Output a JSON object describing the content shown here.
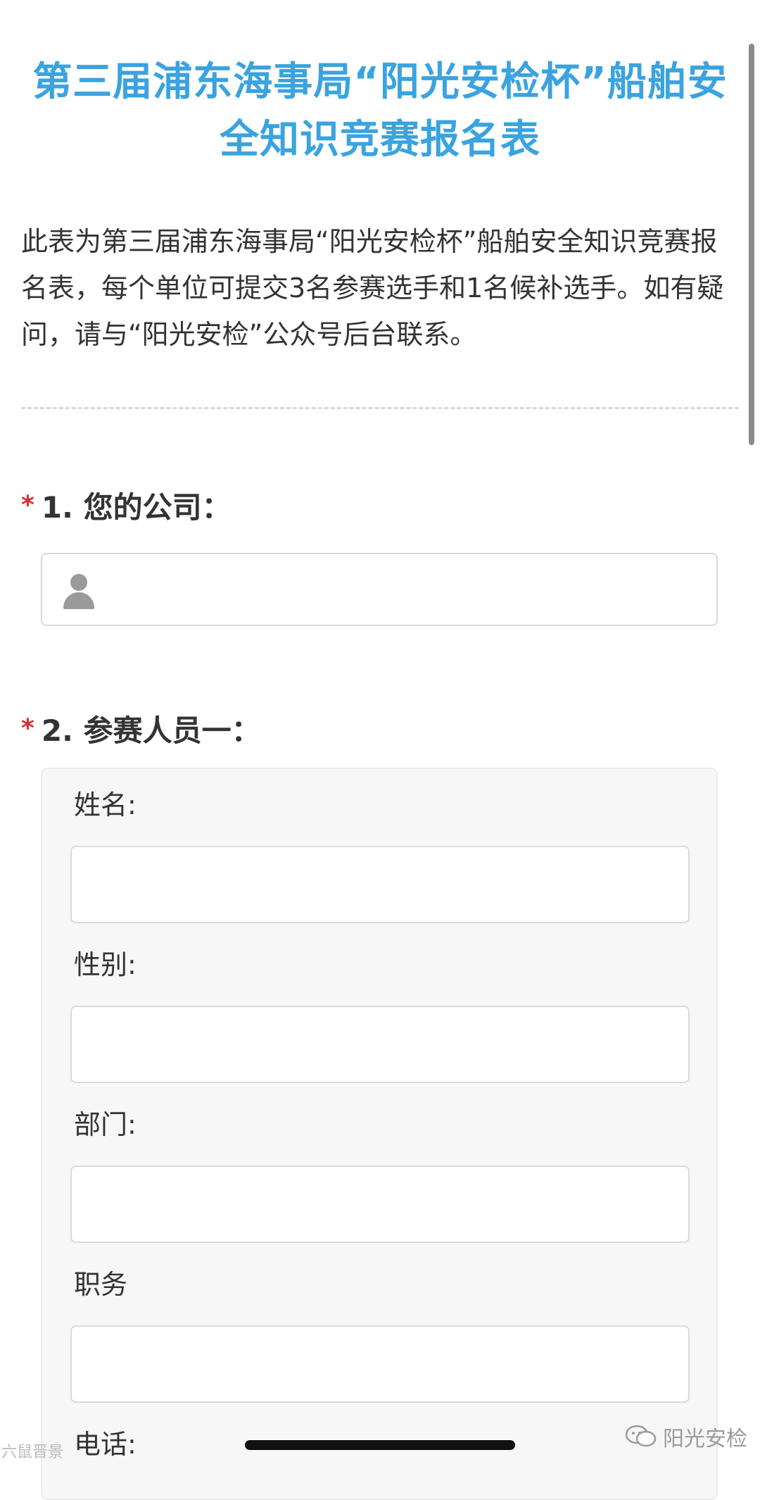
{
  "form": {
    "title": "第三届浦东海事局“阳光安检杯”船舶安全知识竞赛报名表",
    "intro": "此表为第三届浦东海事局“阳光安检杯”船舶安全知识竞赛报名表，每个单位可提交3名参赛选手和1名候补选手。如有疑问，请与“阳光安检”公众号后台联系。"
  },
  "questions": [
    {
      "required_mark": "*",
      "label": "1. 您的公司："
    },
    {
      "required_mark": "*",
      "label": "2. 参赛人员一：",
      "fields": [
        {
          "label": "姓名:"
        },
        {
          "label": "性别:"
        },
        {
          "label": "部门:"
        },
        {
          "label": "职务"
        },
        {
          "label": "电话:"
        }
      ]
    }
  ],
  "icons": {
    "company_field_icon": "person-icon",
    "watermark_icon": "wechat-icon"
  },
  "watermark": {
    "account": "阳光安检",
    "left_text": "六鼠晋景"
  },
  "colors": {
    "title": "#3aa3e0",
    "required": "#d32f2f",
    "panel_bg": "#f7f7f7"
  }
}
